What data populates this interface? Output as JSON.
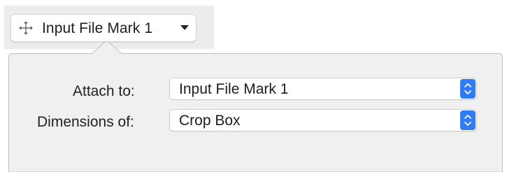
{
  "toolbar": {
    "mark_button_label": "Input File Mark 1",
    "mark_button_icon": "move-icon",
    "mark_button_caret_icon": "chevron-down-icon"
  },
  "popover": {
    "fields": [
      {
        "label": "Attach to:",
        "value": "Input File Mark 1",
        "control_icon": "up-down-stepper-icon"
      },
      {
        "label": "Dimensions of:",
        "value": "Crop Box",
        "control_icon": "up-down-stepper-icon"
      }
    ]
  },
  "colors": {
    "popover_background": "#f0f0f0",
    "popover_border": "#bfbfbf",
    "accent": "#2f7cf6",
    "toolbar_background": "#ececec"
  }
}
